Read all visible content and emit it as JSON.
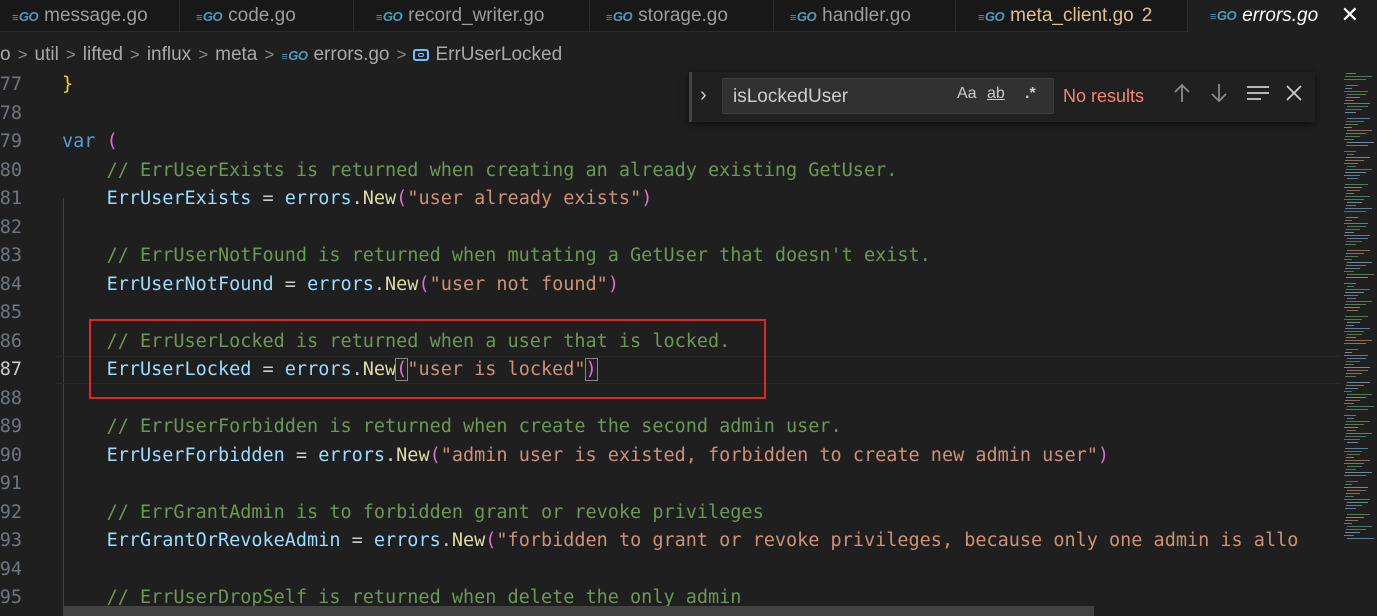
{
  "tabs": [
    {
      "label": "message.go",
      "badge": ""
    },
    {
      "label": "code.go",
      "badge": ""
    },
    {
      "label": "record_writer.go",
      "badge": ""
    },
    {
      "label": "storage.go",
      "badge": ""
    },
    {
      "label": "handler.go",
      "badge": ""
    },
    {
      "label": "meta_client.go",
      "badge": "2"
    },
    {
      "label": "errors.go",
      "badge": ""
    }
  ],
  "tab_icon_text": "GO",
  "active_tab_close": "✕",
  "breadcrumb": {
    "items": [
      "o",
      "util",
      "lifted",
      "influx",
      "meta",
      "errors.go",
      "ErrUserLocked"
    ],
    "separator": ">"
  },
  "find": {
    "query": "isLockedUser",
    "match_case": "Aa",
    "whole_word": "ab",
    "regex": ".*",
    "status": "No results",
    "toggle_glyph": "›"
  },
  "editor": {
    "lines": [
      {
        "n": "77",
        "code": "}"
      },
      {
        "n": "78",
        "code": ""
      },
      {
        "n": "79",
        "code": "var ("
      },
      {
        "n": "80",
        "code": "    // ErrUserExists is returned when creating an already existing GetUser."
      },
      {
        "n": "81",
        "code": "    ErrUserExists = errors.New(\"user already exists\")"
      },
      {
        "n": "82",
        "code": ""
      },
      {
        "n": "83",
        "code": "    // ErrUserNotFound is returned when mutating a GetUser that doesn't exist."
      },
      {
        "n": "84",
        "code": "    ErrUserNotFound = errors.New(\"user not found\")"
      },
      {
        "n": "85",
        "code": ""
      },
      {
        "n": "86",
        "code": "    // ErrUserLocked is returned when a user that is locked."
      },
      {
        "n": "87",
        "code": "    ErrUserLocked = errors.New(\"user is locked\")"
      },
      {
        "n": "88",
        "code": ""
      },
      {
        "n": "89",
        "code": "    // ErrUserForbidden is returned when create the second admin user."
      },
      {
        "n": "90",
        "code": "    ErrUserForbidden = errors.New(\"admin user is existed, forbidden to create new admin user\")"
      },
      {
        "n": "91",
        "code": ""
      },
      {
        "n": "92",
        "code": "    // ErrGrantAdmin is to forbidden grant or revoke privileges"
      },
      {
        "n": "93",
        "code": "    ErrGrantOrRevokeAdmin = errors.New(\"forbidden to grant or revoke privileges, because only one admin is allo"
      },
      {
        "n": "94",
        "code": ""
      },
      {
        "n": "95",
        "code": "    // ErrUserDropSelf is returned when delete the only admin"
      }
    ],
    "current_line": "87"
  },
  "colors": {
    "background": "#1f1f1f",
    "comment": "#6a9955",
    "identifier": "#9cdcfe",
    "function": "#dcdcaa",
    "string": "#ce9178",
    "keyword": "#569cd6",
    "annotation_box": "#e0252b",
    "no_results": "#f48771"
  },
  "icons": [
    "go-file-icon",
    "symbol-variable-icon",
    "chevron-right-icon",
    "arrow-up-icon",
    "arrow-down-icon",
    "find-in-selection-icon",
    "close-icon"
  ]
}
